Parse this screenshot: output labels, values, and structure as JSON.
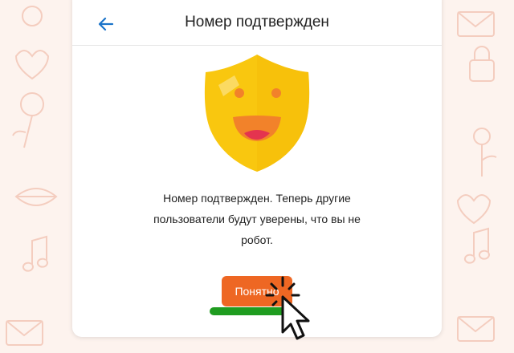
{
  "header": {
    "title": "Номер подтвержден",
    "back_icon": "arrow-left-icon"
  },
  "illustration": {
    "icon": "smiling-shield-icon",
    "shield_color": "#f9c70f",
    "mouth_color": "#f2822a"
  },
  "message": {
    "text": "Номер подтвержден. Теперь другие пользователи будут уверены, что вы не робот."
  },
  "actions": {
    "ok_label": "Понятно",
    "ok_color": "#ee6723"
  },
  "colors": {
    "accent": "#1a73c9",
    "background": "#fdf3ee",
    "highlight": "#1f9c20"
  }
}
